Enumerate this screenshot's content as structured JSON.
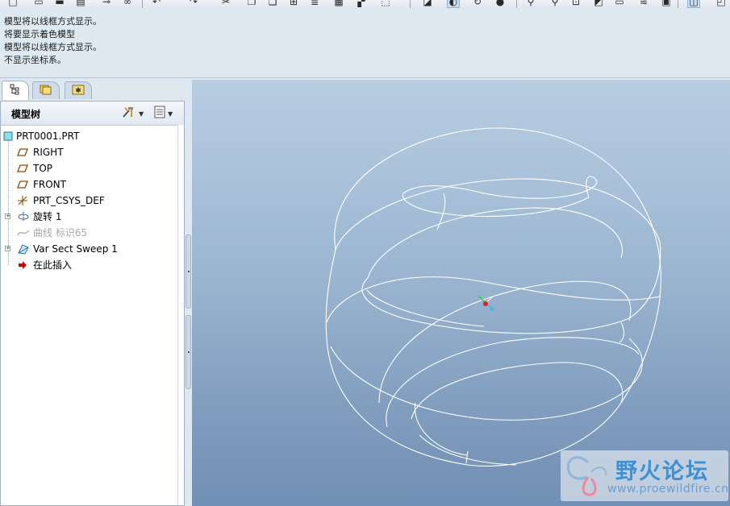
{
  "toolbar": {
    "buttons": [
      {
        "icon": "new-file-icon",
        "glyph": "□"
      },
      {
        "icon": "open-icon",
        "glyph": "▭"
      },
      {
        "icon": "save-icon",
        "glyph": "▬"
      },
      {
        "icon": "print-icon",
        "glyph": "▤"
      },
      {
        "icon": "paste-icon",
        "glyph": "⊸"
      },
      {
        "icon": "link-icon",
        "glyph": "∞"
      },
      {
        "icon": "undo-icon",
        "glyph": "↶"
      },
      {
        "icon": "redo-icon",
        "glyph": "↷"
      },
      {
        "icon": "cut-icon",
        "glyph": "✂"
      },
      {
        "icon": "copy-icon",
        "glyph": "❐"
      },
      {
        "icon": "paste-special-icon",
        "glyph": "❏"
      },
      {
        "icon": "select-icon",
        "glyph": "⊞"
      },
      {
        "icon": "regenerate-icon",
        "glyph": "≣"
      },
      {
        "icon": "model-tree-icon",
        "glyph": "▦"
      },
      {
        "icon": "window-icon",
        "glyph": "▞"
      },
      {
        "icon": "dashed-select-icon",
        "glyph": "⬚"
      },
      {
        "icon": "repaint-icon",
        "glyph": "◪"
      },
      {
        "icon": "shading-icon",
        "glyph": "◐"
      },
      {
        "icon": "spin-center-icon",
        "glyph": "↻"
      },
      {
        "icon": "render-sphere-icon",
        "glyph": "●"
      },
      {
        "icon": "zoom-in-icon",
        "glyph": "⚲"
      },
      {
        "icon": "zoom-out-icon",
        "glyph": "⚲"
      },
      {
        "icon": "refit-icon",
        "glyph": "⊡"
      },
      {
        "icon": "orient-icon",
        "glyph": "◩"
      },
      {
        "icon": "saved-views-icon",
        "glyph": "▭"
      },
      {
        "icon": "layers-icon",
        "glyph": "≋"
      },
      {
        "icon": "view-manager-icon",
        "glyph": "▣"
      },
      {
        "icon": "wireframe-icon",
        "glyph": "◫"
      },
      {
        "icon": "hidden-line-icon",
        "glyph": "◰"
      }
    ]
  },
  "messages": [
    "模型将以线框方式显示。",
    "将要显示着色模型",
    "模型将以线框方式显示。",
    "不显示坐标系。"
  ],
  "nav_tabs": [
    {
      "icon": "model-tree-tab-icon",
      "glyph": "⊟"
    },
    {
      "icon": "folder-browser-tab-icon",
      "glyph": "▤"
    },
    {
      "icon": "favorites-tab-icon",
      "glyph": "✱"
    }
  ],
  "model_tree": {
    "title": "模型树",
    "settings_icon": "tree-settings-icon",
    "show_icon": "tree-show-icon",
    "items": [
      {
        "label": "PRT0001.PRT",
        "icon": "part-icon",
        "dim": false,
        "expandable": false
      },
      {
        "label": "RIGHT",
        "icon": "datum-plane-icon",
        "dim": false,
        "expandable": false
      },
      {
        "label": "TOP",
        "icon": "datum-plane-icon",
        "dim": false,
        "expandable": false
      },
      {
        "label": "FRONT",
        "icon": "datum-plane-icon",
        "dim": false,
        "expandable": false
      },
      {
        "label": "PRT_CSYS_DEF",
        "icon": "csys-icon",
        "dim": false,
        "expandable": false
      },
      {
        "label": "旋转 1",
        "icon": "revolve-icon",
        "dim": false,
        "expandable": true
      },
      {
        "label": "曲线 标识65",
        "icon": "curve-icon",
        "dim": true,
        "expandable": false
      },
      {
        "label": "Var Sect Sweep 1",
        "icon": "sweep-icon",
        "dim": false,
        "expandable": true
      },
      {
        "label": "在此插入",
        "icon": "insert-here-arrow-icon",
        "dim": false,
        "expandable": false
      }
    ]
  },
  "watermark": {
    "title": "野火论坛",
    "url": "www.proewildfire.cn"
  },
  "colors": {
    "graphics_top": "#b8cde2",
    "graphics_bottom": "#7190b5",
    "wire": "#ffffff",
    "insert_arrow": "#d40000"
  }
}
